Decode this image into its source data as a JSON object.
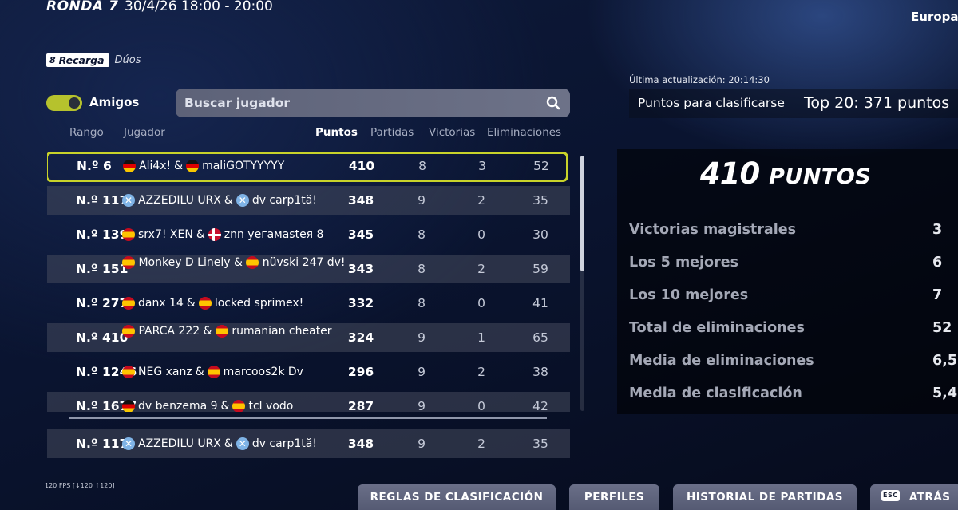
{
  "header": {
    "round": "RONDA 7",
    "time": "30/4/26 18:00 - 20:00",
    "region": "Europa"
  },
  "mode": {
    "badge": "Recarga",
    "sub": "Dúos"
  },
  "friends_toggle": {
    "label": "Amigos",
    "on": true
  },
  "search": {
    "placeholder": "Buscar jugador"
  },
  "columns": {
    "rank": "Rango",
    "player": "Jugador",
    "points": "Puntos",
    "matches": "Partidas",
    "wins": "Victorias",
    "elims": "Eliminaciones"
  },
  "rows": [
    {
      "rank": "N.º 6",
      "p1_flag": "de",
      "p1": "Ali4x!",
      "p2_flag": "de",
      "p2": "maliGOTYYYYY",
      "points": "410",
      "matches": "8",
      "wins": "3",
      "elims": "52"
    },
    {
      "rank": "N.º 117",
      "p1_flag": "xx",
      "p1": "AZZEDILU URX",
      "p2_flag": "xx",
      "p2": "dv carp1tă!",
      "points": "348",
      "matches": "9",
      "wins": "2",
      "elims": "35"
    },
    {
      "rank": "N.º 139",
      "p1_flag": "es",
      "p1": "srx7! XEN",
      "p2_flag": "dk",
      "p2": "znn уегамаstея 8",
      "points": "345",
      "matches": "8",
      "wins": "0",
      "elims": "30"
    },
    {
      "rank": "N.º 151",
      "p1_flag": "es",
      "p1": "Monkey D Linely",
      "p2_flag": "es",
      "p2": "nüvski 247 dv!",
      "points": "343",
      "matches": "8",
      "wins": "2",
      "elims": "59"
    },
    {
      "rank": "N.º 277",
      "p1_flag": "es",
      "p1": "danx 14",
      "p2_flag": "es",
      "p2": "locked sprimex!",
      "points": "332",
      "matches": "8",
      "wins": "0",
      "elims": "41"
    },
    {
      "rank": "N.º 410",
      "p1_flag": "es",
      "p1": "PARCA 222",
      "p2_flag": "es",
      "p2": "rumanian cheater",
      "points": "324",
      "matches": "9",
      "wins": "1",
      "elims": "65"
    },
    {
      "rank": "N.º 1246",
      "p1_flag": "es",
      "p1": "NEG xanz",
      "p2_flag": "es",
      "p2": "marcoos2k Dv",
      "points": "296",
      "matches": "9",
      "wins": "2",
      "elims": "38"
    },
    {
      "rank": "N.º 1677",
      "p1_flag": "de",
      "p1": "dv benzēma 9",
      "p2_flag": "es",
      "p2": "tcl vodo",
      "points": "287",
      "matches": "9",
      "wins": "0",
      "elims": "42"
    }
  ],
  "own_row": {
    "rank": "N.º 117",
    "p1_flag": "xx",
    "p1": "AZZEDILU URX",
    "p2_flag": "xx",
    "p2": "dv carp1tă!",
    "points": "348",
    "matches": "9",
    "wins": "2",
    "elims": "35"
  },
  "side_panel": {
    "updated": "Última actualización: 20:14:30",
    "qualify_label": "Puntos para clasificarse",
    "qualify_value": "Top 20: 371 puntos",
    "points_number": "410",
    "points_unit": "PUNTOS",
    "stats": [
      {
        "label": "Victorias magistrales",
        "value": "3"
      },
      {
        "label": "Los 5 mejores",
        "value": "6"
      },
      {
        "label": "Los 10 mejores",
        "value": "7"
      },
      {
        "label": "Total de eliminaciones",
        "value": "52"
      },
      {
        "label": "Media de eliminaciones",
        "value": "6,5"
      },
      {
        "label": "Media de clasificación",
        "value": "5,4"
      }
    ]
  },
  "footer": {
    "fps": "120 FPS [↓120 ↑120]",
    "rules": "REGLAS DE CLASIFICACIÓN",
    "profiles": "PERFILES",
    "history": "HISTORIAL DE PARTIDAS",
    "esc_key": "ESC",
    "back": "ATRÁS"
  },
  "colors": {
    "accent": "#c8d32a",
    "toggle": "#b6c22d"
  }
}
